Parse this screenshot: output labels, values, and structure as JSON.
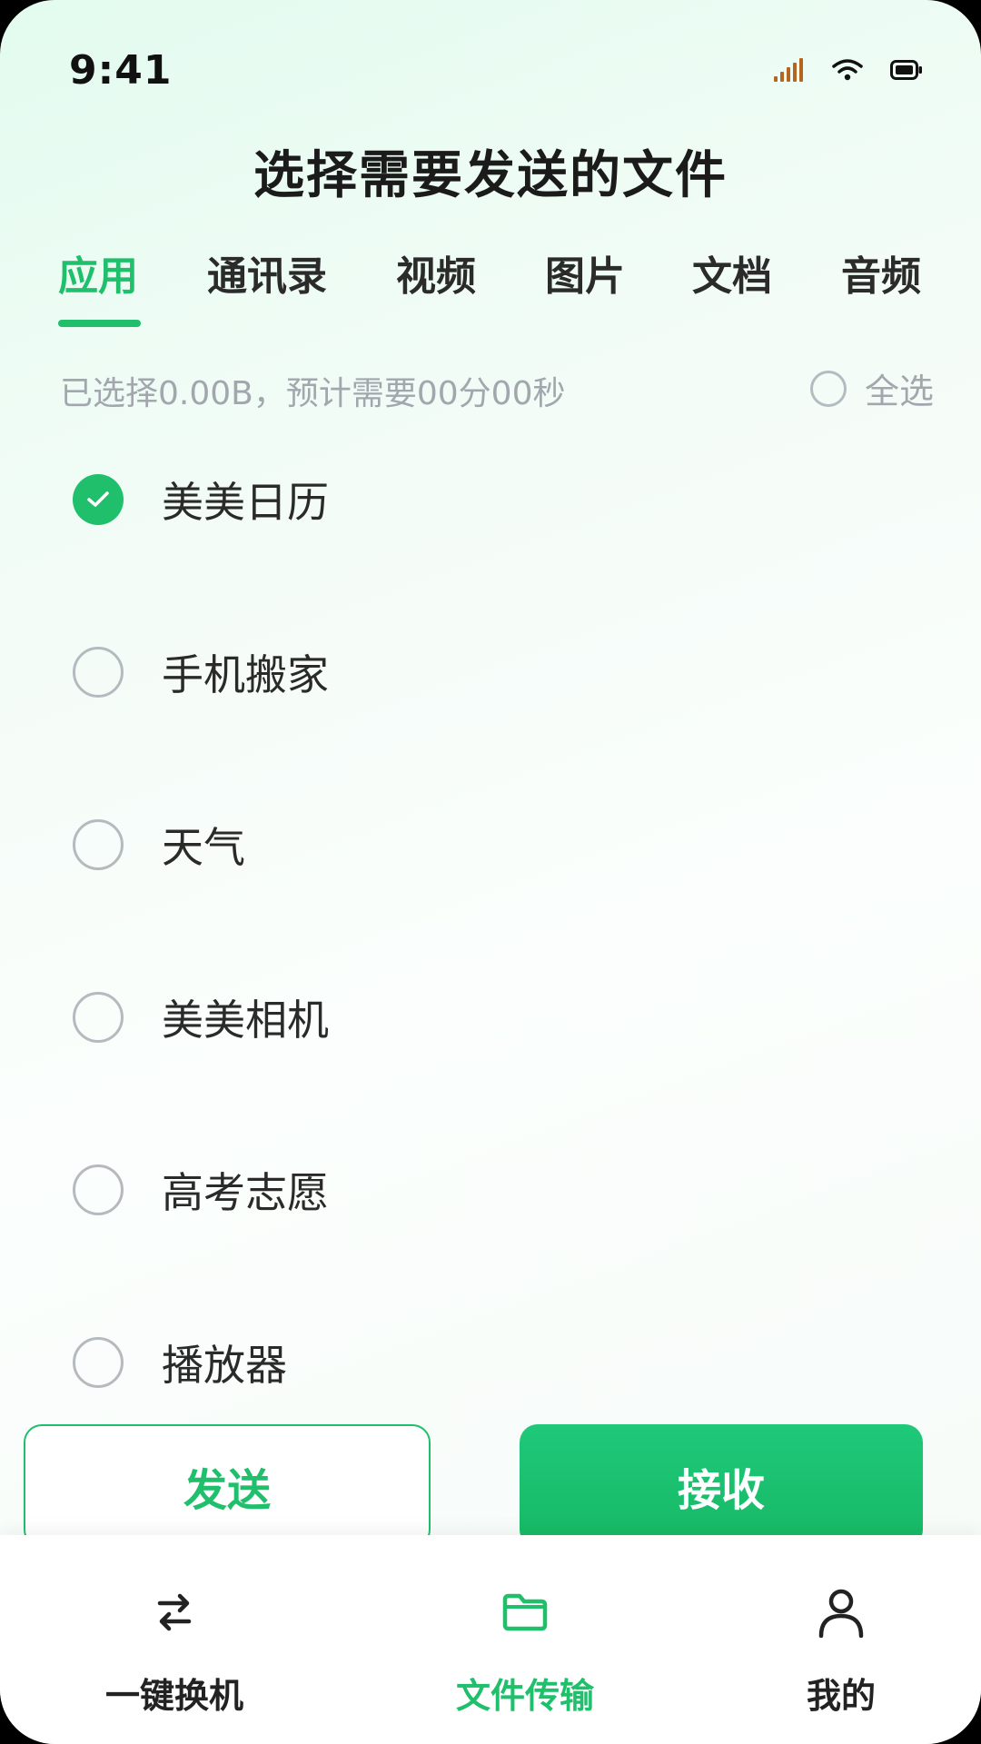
{
  "status_bar": {
    "time": "9:41",
    "icons": [
      "signal-icon",
      "wifi-icon",
      "battery-icon"
    ]
  },
  "header": {
    "title": "选择需要发送的文件"
  },
  "tabs": [
    {
      "label": "应用",
      "active": true
    },
    {
      "label": "通讯录",
      "active": false
    },
    {
      "label": "视频",
      "active": false
    },
    {
      "label": "图片",
      "active": false
    },
    {
      "label": "文档",
      "active": false
    },
    {
      "label": "音频",
      "active": false
    }
  ],
  "summary": {
    "text": "已选择0.00B，预计需要00分00秒",
    "select_all_label": "全选",
    "select_all_checked": false
  },
  "apps": [
    {
      "name": "美美日历",
      "checked": true
    },
    {
      "name": "手机搬家",
      "checked": false
    },
    {
      "name": "天气",
      "checked": false
    },
    {
      "name": "美美相机",
      "checked": false
    },
    {
      "name": "高考志愿",
      "checked": false
    },
    {
      "name": "播放器",
      "checked": false
    }
  ],
  "actions": {
    "send_label": "发送",
    "receive_label": "接收"
  },
  "bottom_nav": [
    {
      "label": "一键换机",
      "icon": "swap-arrows-icon",
      "active": false
    },
    {
      "label": "文件传输",
      "icon": "folder-icon",
      "active": true
    },
    {
      "label": "我的",
      "icon": "user-icon",
      "active": false
    }
  ],
  "colors": {
    "accent": "#1fbf6c",
    "text_primary": "#2a2a2a",
    "text_muted": "#a2a7ad",
    "signal_icon": "#b5651d"
  }
}
